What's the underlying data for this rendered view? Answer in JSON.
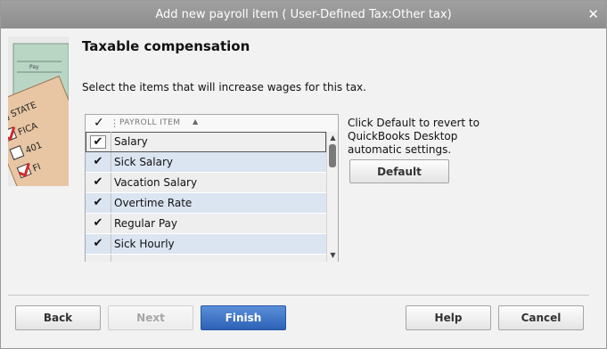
{
  "window": {
    "title": "Add new payroll item ( User-Defined Tax:Other tax)",
    "close_glyph": "✕"
  },
  "art_labels": {
    "state": "STATE",
    "fica": "FICA",
    "k401": "401",
    "fi": "FI",
    "pay": "Pay"
  },
  "heading": "Taxable compensation",
  "instruction": "Select the items that will increase wages for this tax.",
  "grid": {
    "header_check": "✓",
    "header_label": "PAYROLL ITEM",
    "sort_glyph": "▲",
    "scroll_up_glyph": "▲",
    "scroll_down_glyph": "▼",
    "rows": [
      {
        "checked": true,
        "check": "✔",
        "name": "Salary"
      },
      {
        "checked": true,
        "check": "✔",
        "name": "Sick Salary"
      },
      {
        "checked": true,
        "check": "✔",
        "name": "Vacation Salary"
      },
      {
        "checked": true,
        "check": "✔",
        "name": "Overtime Rate"
      },
      {
        "checked": true,
        "check": "✔",
        "name": "Regular Pay"
      },
      {
        "checked": true,
        "check": "✔",
        "name": "Sick Hourly"
      }
    ]
  },
  "side_note": "Click Default to revert to QuickBooks Desktop automatic settings.",
  "buttons": {
    "default": "Default",
    "back": "Back",
    "next": "Next",
    "finish": "Finish",
    "help": "Help",
    "cancel": "Cancel"
  },
  "colors": {
    "primary": "#2d62b8",
    "alt_row": "#dbe4f1",
    "checkmark_red": "#d42a2a"
  }
}
